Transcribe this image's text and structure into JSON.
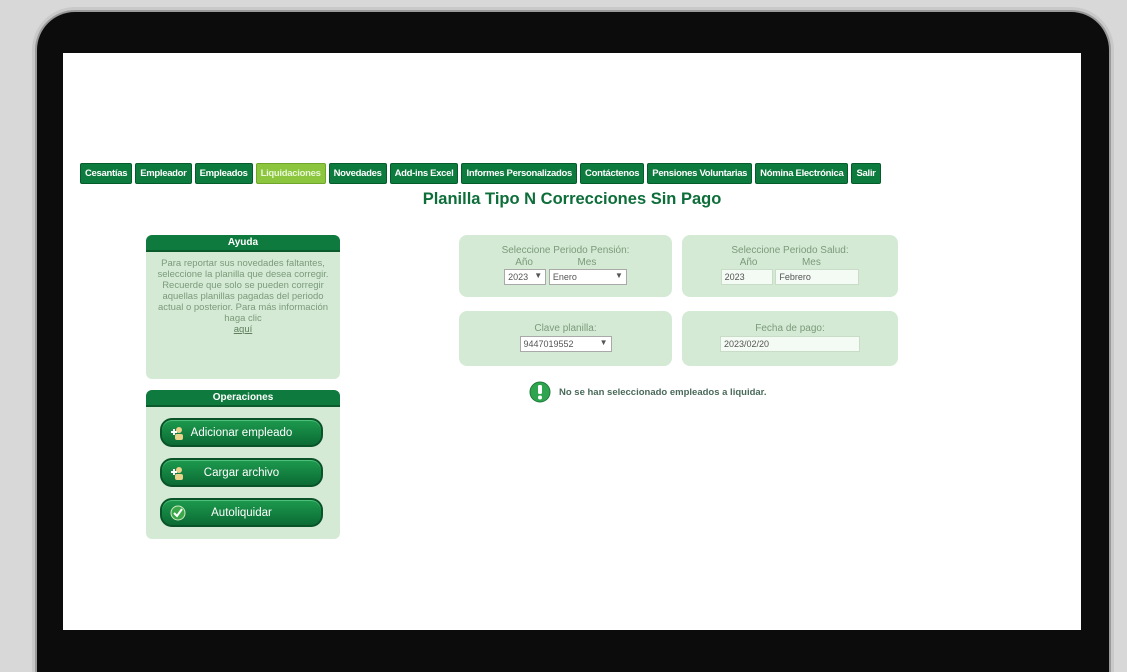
{
  "nav": [
    {
      "label": "Cesantías",
      "active": false
    },
    {
      "label": "Empleador",
      "active": false
    },
    {
      "label": "Empleados",
      "active": false
    },
    {
      "label": "Liquidaciones",
      "active": true
    },
    {
      "label": "Novedades",
      "active": false
    },
    {
      "label": "Add-ins Excel",
      "active": false
    },
    {
      "label": "Informes Personalizados",
      "active": false
    },
    {
      "label": "Contáctenos",
      "active": false
    },
    {
      "label": "Pensiones Voluntarias",
      "active": false
    },
    {
      "label": "Nómina Electrónica",
      "active": false
    },
    {
      "label": "Salir",
      "active": false
    }
  ],
  "title": "Planilla Tipo N Correcciones Sin Pago",
  "help": {
    "header": "Ayuda",
    "text": "Para reportar sus novedades faltantes, seleccione la planilla que desea corregir. Recuerde que solo se pueden corregir aquellas planillas pagadas del periodo actual o posterior. Para más información haga clic",
    "link": "aquí"
  },
  "operations": {
    "header": "Operaciones",
    "buttons": [
      {
        "label": "Adicionar empleado",
        "icon": "add-user-icon"
      },
      {
        "label": "Cargar archivo",
        "icon": "upload-user-icon"
      },
      {
        "label": "Autoliquidar",
        "icon": "check-icon"
      }
    ]
  },
  "pension": {
    "label": "Seleccione Periodo Pensión:",
    "year_label": "Año",
    "month_label": "Mes",
    "year": "2023",
    "month": "Enero"
  },
  "salud": {
    "label": "Seleccione Periodo Salud:",
    "year_label": "Año",
    "month_label": "Mes",
    "year": "2023",
    "month": "Febrero"
  },
  "clave": {
    "label": "Clave planilla:",
    "value": "9447019552"
  },
  "fecha": {
    "label": "Fecha de pago:",
    "value": "2023/02/20"
  },
  "message": "No se han seleccionado empleados a liquidar.",
  "colors": {
    "primary": "#0d7a3e",
    "active": "#8cc63f",
    "panel": "#d4ead4"
  }
}
